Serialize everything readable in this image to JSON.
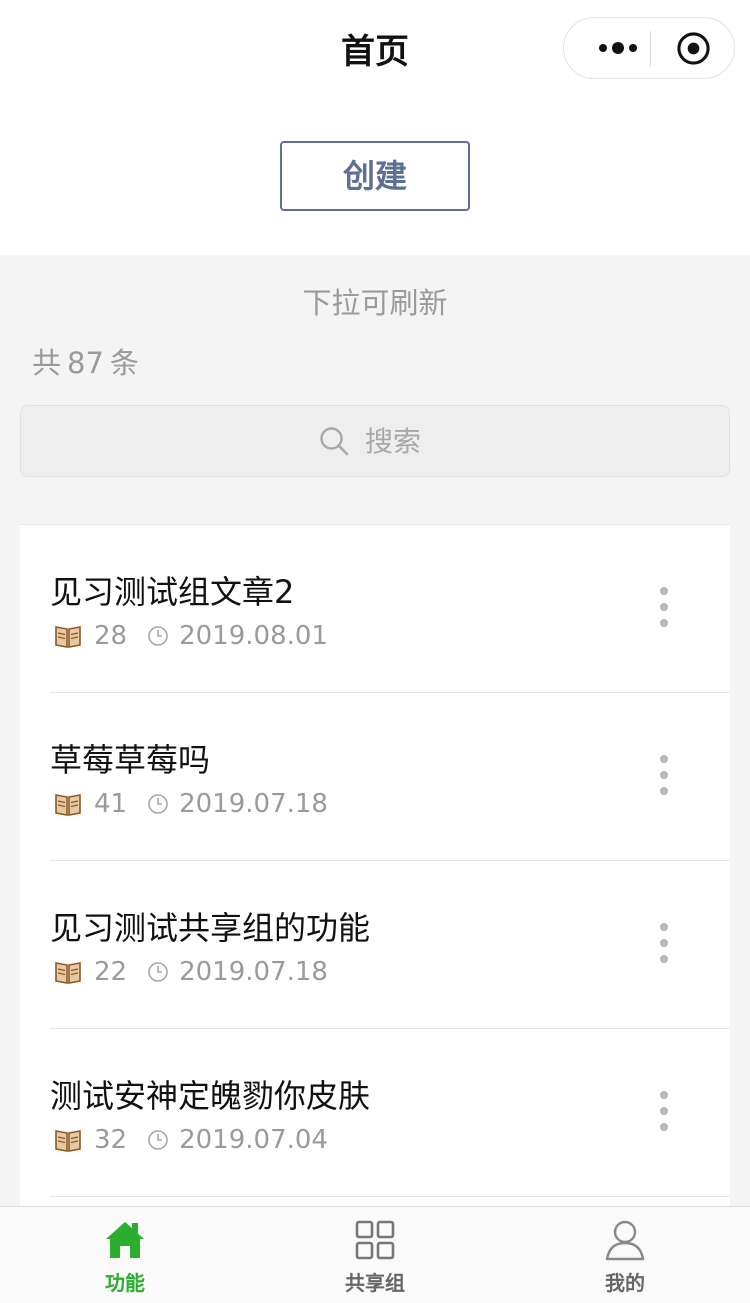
{
  "nav": {
    "title": "首页",
    "more_icon": "more-dots-icon",
    "close_icon": "target-circle-icon"
  },
  "header": {
    "create_label": "创建"
  },
  "pull_hint": "下拉可刷新",
  "count": {
    "prefix": "共",
    "value": "87",
    "suffix": "条"
  },
  "search": {
    "placeholder": "搜索",
    "icon": "search-icon"
  },
  "articles": [
    {
      "title": "见习测试组文章2",
      "views": "28",
      "date": "2019.08.01"
    },
    {
      "title": "草莓草莓吗",
      "views": "41",
      "date": "2019.07.18"
    },
    {
      "title": "见习测试共享组的功能",
      "views": "22",
      "date": "2019.07.18"
    },
    {
      "title": "测试安神定魄勠你皮肤",
      "views": "32",
      "date": "2019.07.04"
    }
  ],
  "tabbar": {
    "items": [
      {
        "label": "功能",
        "icon": "home-icon",
        "active": true
      },
      {
        "label": "共享组",
        "icon": "grid-icon",
        "active": false
      },
      {
        "label": "我的",
        "icon": "user-icon",
        "active": false
      }
    ]
  },
  "colors": {
    "accent_green": "#2bad2d",
    "button_blue": "#5d6f94",
    "muted_gray": "#9a9a9a",
    "background": "#f4f4f4"
  }
}
